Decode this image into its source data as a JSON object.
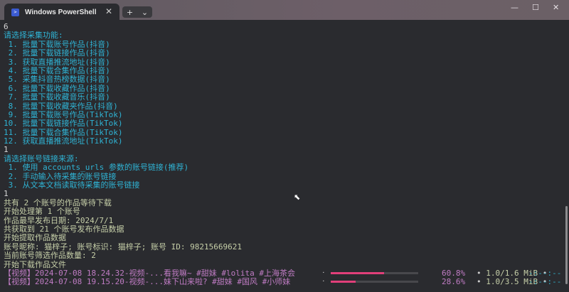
{
  "window": {
    "tab_title": "Windows PowerShell",
    "tab_icon": "powershell-icon",
    "new_tab": "+",
    "dropdown": "⌄",
    "minimize": "—",
    "maximize": "☐",
    "close": "✕"
  },
  "colors": {
    "prompt": "#2fb3d4",
    "info": "#c6cfa8",
    "video": "#c07cc4",
    "bar": "#e13f7a"
  },
  "terminal": {
    "lines": [
      {
        "text": "6",
        "cls": ""
      },
      {
        "text": "请选择采集功能:",
        "cls": "cy"
      },
      {
        "text": " 1. 批量下载账号作品(抖音)",
        "cls": "cy"
      },
      {
        "text": " 2. 批量下载链接作品(抖音)",
        "cls": "cy"
      },
      {
        "text": " 3. 获取直播推流地址(抖音)",
        "cls": "cy"
      },
      {
        "text": " 4. 批量下载合集作品(抖音)",
        "cls": "cy"
      },
      {
        "text": " 5. 采集抖音热榜数据(抖音)",
        "cls": "cy"
      },
      {
        "text": " 6. 批量下载收藏作品(抖音)",
        "cls": "cy"
      },
      {
        "text": " 7. 批量下载收藏音乐(抖音)",
        "cls": "cy"
      },
      {
        "text": " 8. 批量下载收藏夹作品(抖音)",
        "cls": "cy"
      },
      {
        "text": " 9. 批量下载账号作品(TikTok)",
        "cls": "cy"
      },
      {
        "text": "10. 批量下载链接作品(TikTok)",
        "cls": "cy"
      },
      {
        "text": "11. 批量下载合集作品(TikTok)",
        "cls": "cy"
      },
      {
        "text": "12. 获取直播推流地址(TikTok)",
        "cls": "cy"
      },
      {
        "text": "1",
        "cls": ""
      },
      {
        "text": "请选择账号链接来源:",
        "cls": "cy"
      },
      {
        "text": " 1. 使用 accounts_urls 参数的账号链接(推荐)",
        "cls": "cy"
      },
      {
        "text": " 2. 手动输入待采集的账号链接",
        "cls": "cy"
      },
      {
        "text": " 3. 从文本文档读取待采集的账号链接",
        "cls": "cy"
      },
      {
        "text": "1",
        "cls": ""
      },
      {
        "text": "共有 2 个账号的作品等待下载",
        "cls": "gr"
      },
      {
        "text": "开始处理第 1 个账号",
        "cls": "gr"
      },
      {
        "text": "作品最早发布日期: 2024/7/1",
        "cls": "gr"
      },
      {
        "text": "共获取到 21 个账号发布作品数据",
        "cls": "gr"
      },
      {
        "text": "开始提取作品数据",
        "cls": "gr"
      },
      {
        "text": "账号昵称: 猫梓子; 账号标识: 猫梓子; 账号 ID: 98215669621",
        "cls": "gr"
      },
      {
        "text": "当前账号筛选作品数量: 2",
        "cls": "gr"
      },
      {
        "text": "开始下载作品文件",
        "cls": "gr"
      }
    ],
    "downloads": [
      {
        "name": "【视频】2024-07-08 18.24.32-视频-...看我嘛~ #甜妹 #lolita #上海茶会",
        "progress": 60.8,
        "percent": "60.8%",
        "size": "1.0/1.6 MiB",
        "eta": "-:--:--"
      },
      {
        "name": "【视频】2024-07-08 19.15.20-视频-...妹下山来啦? #甜妹 #国风 #小师妹",
        "progress": 28.6,
        "percent": "28.6%",
        "size": "1.0/3.5 MiB",
        "eta": "-:--:--"
      }
    ]
  }
}
